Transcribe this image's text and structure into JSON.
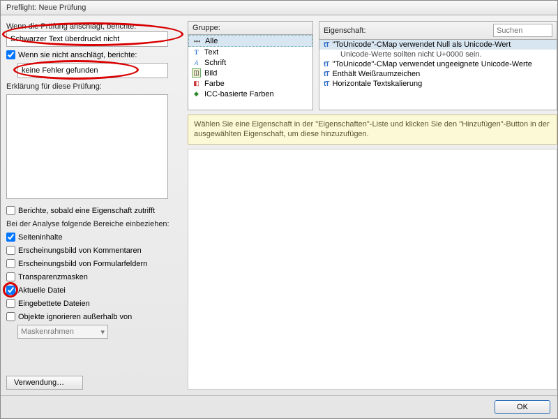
{
  "title": "Preflight: Neue Prüfung",
  "left": {
    "when_hits_label": "Wenn die Prüfung anschlägt, berichte:",
    "when_hits_value": "Schwarzer Text überdruckt nicht",
    "when_not_hits_label": "Wenn sie nicht anschlägt, berichte:",
    "when_not_hits_value": "keine Fehler gefunden",
    "explain_label": "Erklärung für diese Prüfung:",
    "report_asap": "Berichte, sobald eine Eigenschaft zutrifft",
    "analyze_label": "Bei der Analyse folgende Bereiche einbeziehen:",
    "chk_seiten": "Seiteninhalte",
    "chk_komm": "Erscheinungsbild von Kommentaren",
    "chk_form": "Erscheinungsbild von Formularfeldern",
    "chk_trans": "Transparenzmasken",
    "chk_akt": "Aktuelle Datei",
    "chk_emb": "Eingebettete Dateien",
    "chk_ign": "Objekte ignorieren außerhalb von",
    "dd_mask": "Maskenrahmen",
    "verwendung": "Verwendung…"
  },
  "right": {
    "gruppe_label": "Gruppe:",
    "gruppe": [
      {
        "icon": "dots",
        "label": "Alle"
      },
      {
        "icon": "T",
        "label": "Text"
      },
      {
        "icon": "A",
        "label": "Schrift"
      },
      {
        "icon": "img",
        "label": "Bild"
      },
      {
        "icon": "pal",
        "label": "Farbe"
      },
      {
        "icon": "icc",
        "label": "ICC-basierte Farben"
      }
    ],
    "eig_label": "Eigenschaft:",
    "search_ph": "Suchen",
    "eig": [
      {
        "label": "\"ToUnicode\"-CMap verwendet Null als Unicode-Wert",
        "sel": true
      },
      {
        "sub": "Unicode-Werte sollten nicht U+0000 sein."
      },
      {
        "label": "\"ToUnicode\"-CMap verwendet ungeeignete Unicode-Werte"
      },
      {
        "label": "Enthält Weißraumzeichen"
      },
      {
        "label": "Horizontale Textskalierung"
      }
    ],
    "hint": "Wählen Sie eine Eigenschaft in der \"Eigenschaften\"-Liste und klicken Sie den \"Hinzufügen\"-Button in der ausgewählten Eigenschaft, um diese hinzuzufügen."
  },
  "footer": {
    "ok": "OK"
  }
}
